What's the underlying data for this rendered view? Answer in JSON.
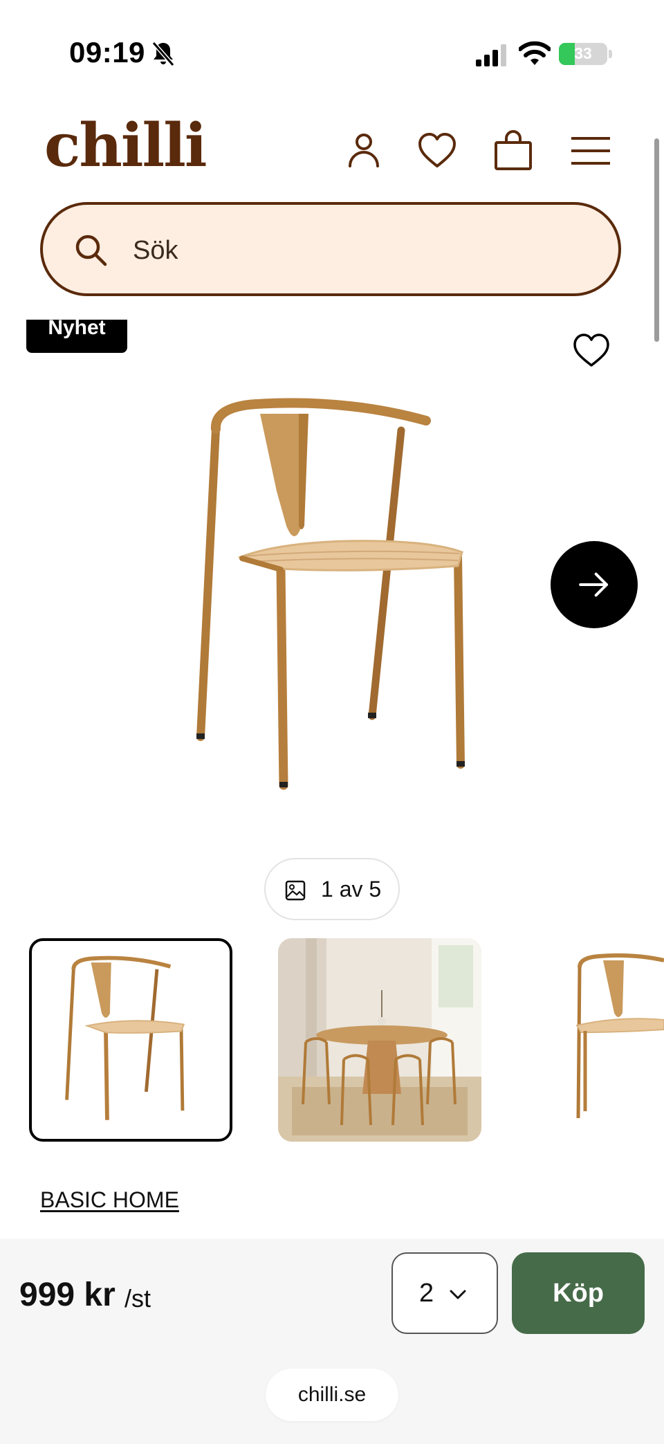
{
  "status_bar": {
    "time": "09:19",
    "battery": "33",
    "battery_level": 0.33
  },
  "header": {
    "logo": "chilli",
    "icons": [
      "user-icon",
      "heart-icon",
      "bag-icon",
      "menu-icon"
    ]
  },
  "search": {
    "placeholder": "Sök"
  },
  "product": {
    "badge": "Nyhet",
    "image_counter": "1 av 5",
    "thumbnails": [
      "chair",
      "dining-room",
      "chair"
    ],
    "brand": "BASIC HOME"
  },
  "buy_bar": {
    "price": "999 kr",
    "unit": "/st",
    "quantity": "2",
    "buy_label": "Köp"
  },
  "browser": {
    "url": "chilli.se"
  },
  "colors": {
    "brand": "#5a2a0c",
    "search_bg": "#fdeee1",
    "buy_button": "#466b48",
    "badge_bg": "#000000"
  }
}
